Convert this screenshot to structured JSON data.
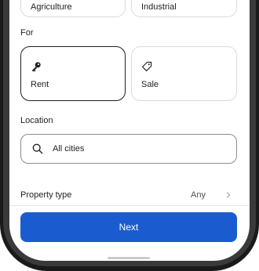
{
  "category_cards": [
    {
      "label": "Agriculture"
    },
    {
      "label": "Industrial"
    }
  ],
  "for_section": {
    "title": "For",
    "options": [
      {
        "label": "Rent",
        "icon": "key-icon",
        "selected": true
      },
      {
        "label": "Sale",
        "icon": "tag-icon",
        "selected": false
      }
    ]
  },
  "location": {
    "title": "Location",
    "search_value": "All cities",
    "icon": "search-icon"
  },
  "property_type": {
    "label": "Property type",
    "value": "Any",
    "icon": "chevron-right-icon"
  },
  "next_button": {
    "label": "Next"
  },
  "colors": {
    "accent": "#1a5ccf",
    "card_border": "#d9dbe0",
    "selected_border": "#1f1f1f"
  }
}
